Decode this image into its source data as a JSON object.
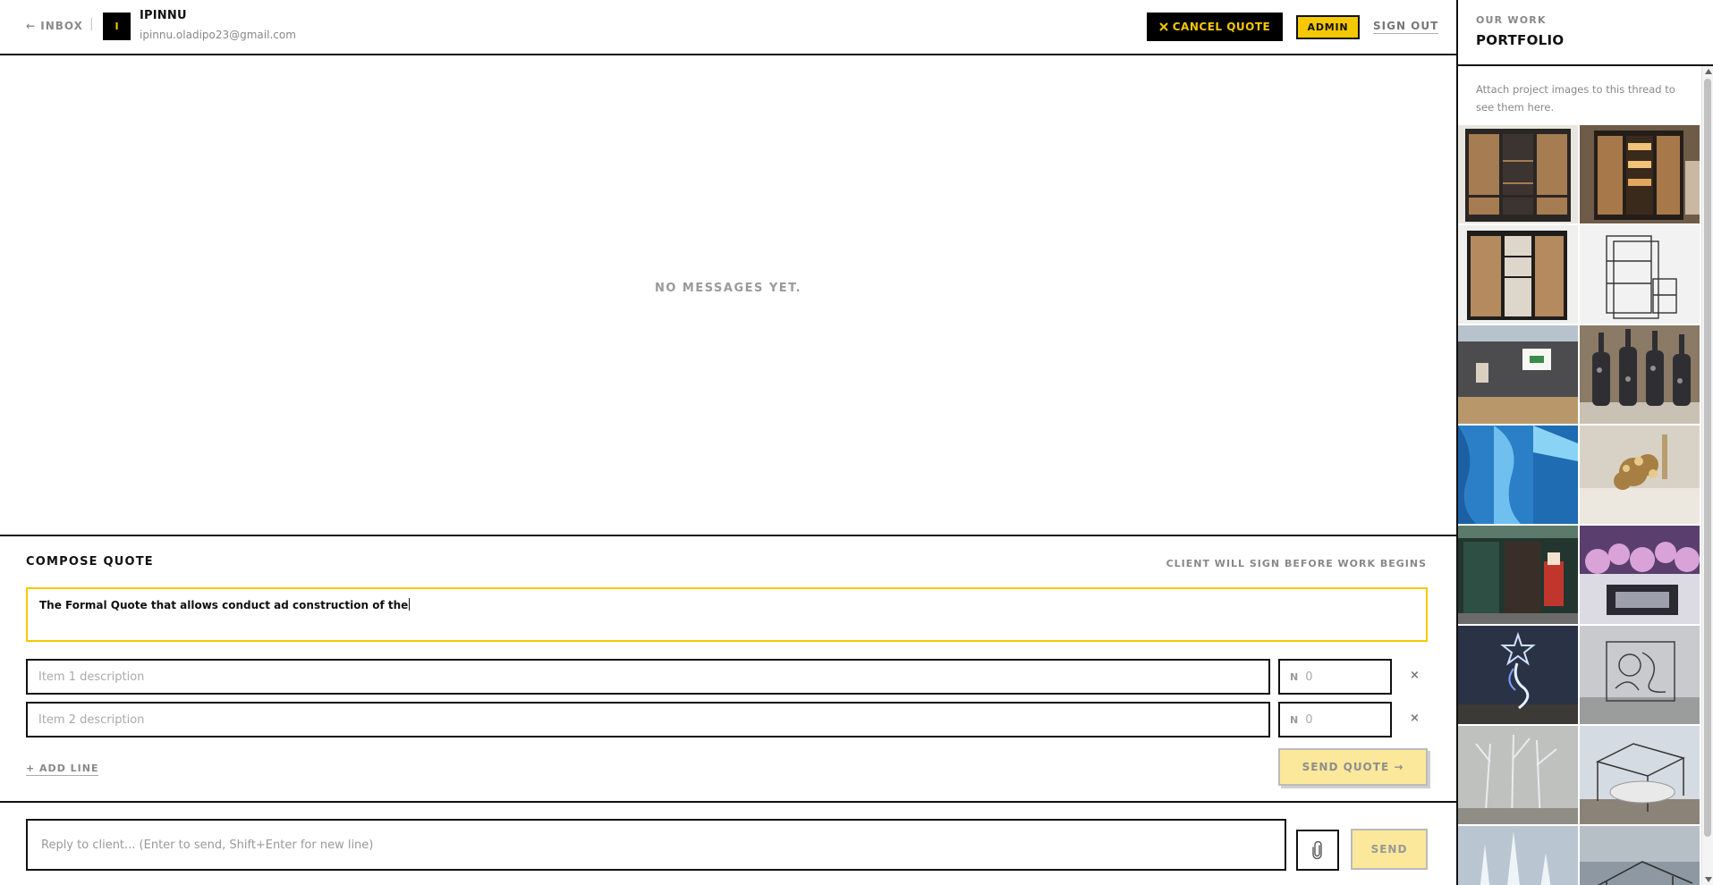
{
  "header": {
    "back_label": "← INBOX",
    "separator": "|",
    "avatar_initial": "I",
    "client_name": "IPINNU",
    "client_email": "ipinnu.oladipo23@gmail.com",
    "cancel_label": "CANCEL QUOTE",
    "cancel_icon": "close-icon",
    "admin_label": "ADMIN",
    "signout_label": "SIGN OUT"
  },
  "messages": {
    "empty_text": "NO MESSAGES YET."
  },
  "compose": {
    "title": "COMPOSE QUOTE",
    "note": "CLIENT WILL SIGN BEFORE WORK BEGINS",
    "quote_title_value": "The Formal Quote that allows conduct ad construction of the",
    "items": [
      {
        "placeholder": "Item 1 description",
        "currency": "N",
        "price_placeholder": "0",
        "remove": "×"
      },
      {
        "placeholder": "Item 2 description",
        "currency": "N",
        "price_placeholder": "0",
        "remove": "×"
      }
    ],
    "add_line_label": "+ ADD LINE",
    "send_quote_label": "SEND QUOTE →"
  },
  "reply": {
    "placeholder": "Reply to client... (Enter to send, Shift+Enter for new line)",
    "attach_icon": "paperclip-icon",
    "send_label": "SEND"
  },
  "sidebar": {
    "eyebrow": "OUR WORK",
    "title": "PORTFOLIO",
    "hint": "Attach project images to this thread to see them here.",
    "thumbnails": [
      "wardrobe-photo",
      "lit-cabinet-photo",
      "wooden-wardrobe-photo",
      "wireframe-shelf-photo",
      "site-wall-photo",
      "glass-bottles-photo",
      "blue-drape-photo",
      "floral-arrangement-photo",
      "shop-front-photo",
      "floral-stage-photo",
      "star-light-photo",
      "metal-art-photo",
      "crystal-tree-photo",
      "tank-frame-photo",
      "ice-sculpture-photo",
      "sky-frame-photo"
    ]
  },
  "colors": {
    "accent_yellow": "#f5c800",
    "pale_yellow": "#fbe89a",
    "ink": "#111111",
    "muted": "#888888"
  }
}
